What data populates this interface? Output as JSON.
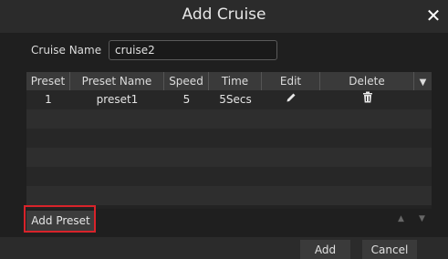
{
  "dialog": {
    "title": "Add Cruise"
  },
  "form": {
    "cruise_name_label": "Cruise Name",
    "cruise_name_value": "cruise2"
  },
  "table": {
    "columns": [
      "Preset",
      "Preset Name",
      "Speed",
      "Time",
      "Edit",
      "Delete"
    ],
    "rows": [
      {
        "preset": "1",
        "preset_name": "preset1",
        "speed": "5",
        "time": "5Secs"
      }
    ]
  },
  "buttons": {
    "add_preset": "Add Preset",
    "add": "Add",
    "cancel": "Cancel"
  },
  "icons": {
    "close": "close-icon",
    "edit": "pencil-icon",
    "delete": "trash-icon",
    "up": "arrow-up-icon",
    "down": "arrow-down-icon",
    "sort": "chevron-down-icon"
  },
  "colors": {
    "highlight": "#d8232a",
    "background": "#1f1f1f",
    "header": "#3a3a3a"
  }
}
